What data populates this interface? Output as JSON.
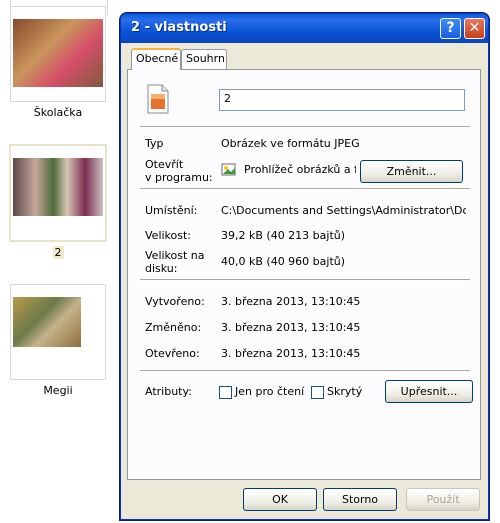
{
  "explorer": {
    "items": [
      {
        "label": "Školačka"
      },
      {
        "label": "2"
      },
      {
        "label": "Megii"
      }
    ]
  },
  "dialog": {
    "title": "2 - vlastnosti",
    "help_glyph": "?",
    "close_glyph": "✕",
    "tabs": [
      {
        "label": "Obecné"
      },
      {
        "label": "Souhrn"
      }
    ],
    "filename": "2",
    "type_label": "Typ",
    "type_value": "Obrázek ve formátu JPEG",
    "open_with_label_line1": "Otevřít",
    "open_with_label_line2": "v programu:",
    "open_with_value": "Prohlížeč obrázků a fa",
    "change_button": "Změnit...",
    "location_label": "Umístění:",
    "location_value": "C:\\Documents and Settings\\Administrator\\Dokume",
    "size_label": "Velikost:",
    "size_value": "39,2 kB (40 213 bajtů)",
    "disk_size_label_line1": "Velikost na",
    "disk_size_label_line2": "disku:",
    "disk_size_value": "40,0 kB (40 960 bajtů)",
    "created_label": "Vytvořeno:",
    "created_value": "3. března 2013, 13:10:45",
    "modified_label": "Změněno:",
    "modified_value": "3. března 2013, 13:10:45",
    "accessed_label": "Otevřeno:",
    "accessed_value": "3. března 2013, 13:10:45",
    "attributes_label": "Atributy:",
    "readonly_label": "Jen pro čtení",
    "readonly_checked": false,
    "hidden_label": "Skrytý",
    "hidden_checked": false,
    "advanced_button": "Upřesnit...",
    "ok_button": "OK",
    "cancel_button": "Storno",
    "apply_button": "Použít"
  }
}
